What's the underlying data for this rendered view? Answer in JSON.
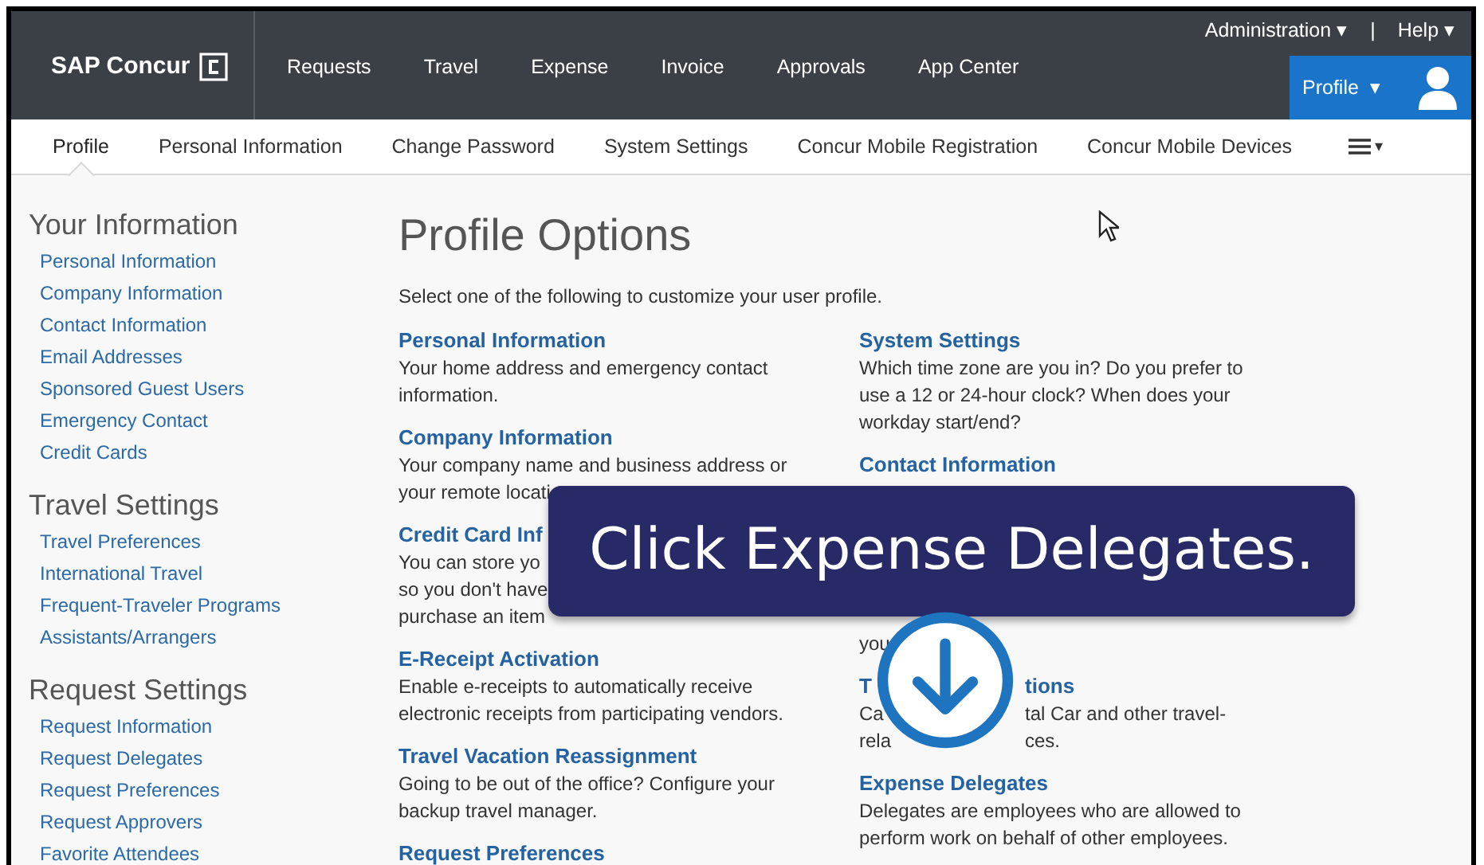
{
  "header": {
    "logo": "SAP Concur",
    "nav": [
      "Requests",
      "Travel",
      "Expense",
      "Invoice",
      "Approvals",
      "App Center"
    ],
    "utility": [
      {
        "label": "Administration",
        "caret": "▾"
      },
      {
        "label": "Help",
        "caret": "▾"
      }
    ],
    "separator": "|",
    "profile_button": {
      "label": "Profile",
      "caret": "▾"
    }
  },
  "subnav": {
    "tabs": [
      {
        "label": "Profile",
        "selected": true
      },
      {
        "label": "Personal Information",
        "selected": false
      },
      {
        "label": "Change Password",
        "selected": false
      },
      {
        "label": "System Settings",
        "selected": false
      },
      {
        "label": "Concur Mobile Registration",
        "selected": false
      },
      {
        "label": "Concur Mobile Devices",
        "selected": false
      }
    ],
    "more_caret": "▾"
  },
  "sidebar": [
    {
      "heading": "Your Information",
      "items": [
        "Personal Information",
        "Company Information",
        "Contact Information",
        "Email Addresses",
        "Sponsored Guest Users",
        "Emergency Contact",
        "Credit Cards"
      ]
    },
    {
      "heading": "Travel Settings",
      "items": [
        "Travel Preferences",
        "International Travel",
        "Frequent-Traveler Programs",
        "Assistants/Arrangers"
      ]
    },
    {
      "heading": "Request Settings",
      "items": [
        "Request Information",
        "Request Delegates",
        "Request Preferences",
        "Request Approvers",
        "Favorite Attendees"
      ]
    }
  ],
  "main": {
    "title": "Profile Options",
    "intro": "Select one of the following to customize your user profile.",
    "columns": [
      [
        {
          "heading": [
            {
              "text": "Personal Information"
            }
          ],
          "lines": [
            {
              "parts": [
                "Your home address and emergency contact"
              ]
            },
            {
              "parts": [
                "information."
              ]
            }
          ]
        },
        {
          "heading": [
            {
              "text": "Company Information"
            }
          ],
          "lines": [
            {
              "parts": [
                "Your company name and business address or"
              ]
            },
            {
              "parts": [
                "your remote locati"
              ]
            }
          ]
        },
        {
          "heading": [
            {
              "text": "Credit Card Inf"
            }
          ],
          "lines": [
            {
              "parts": [
                "You can store yo"
              ]
            },
            {
              "parts": [
                "so you don't have"
              ]
            },
            {
              "parts": [
                "purchase an item"
              ]
            }
          ]
        },
        {
          "heading": [
            {
              "text": "E-Receipt Activation"
            }
          ],
          "lines": [
            {
              "parts": [
                "Enable e-receipts to automatically receive"
              ]
            },
            {
              "parts": [
                "electronic receipts from participating vendors."
              ]
            }
          ]
        },
        {
          "heading": [
            {
              "text": "Travel Vacation Reassignment"
            }
          ],
          "lines": [
            {
              "parts": [
                "Going to be out of the office? Configure your"
              ]
            },
            {
              "parts": [
                "backup travel manager."
              ]
            }
          ]
        },
        {
          "heading": [
            {
              "text": "Request Preferences"
            }
          ]
        }
      ],
      [
        {
          "heading": [
            {
              "text": "System Settings"
            }
          ],
          "lines": [
            {
              "parts": [
                "Which time zone are you in? Do you prefer to"
              ]
            },
            {
              "parts": [
                "use a 12 or 24-hour clock? When does your"
              ]
            },
            {
              "parts": [
                "workday start/end?"
              ]
            }
          ]
        },
        {
          "heading": [
            {
              "text": "Contact Information"
            }
          ],
          "lines": [
            {
              "parts": [
                "you"
              ],
              "covered_above": true
            }
          ]
        },
        {
          "heading": [
            {
              "text": "T"
            },
            {
              "text": "tions"
            }
          ],
          "lines": [
            {
              "parts": [
                "Ca",
                "tal Car and other travel-"
              ]
            },
            {
              "parts": [
                "rela",
                "ces."
              ]
            }
          ]
        },
        {
          "heading": [
            {
              "text": "Expense Delegates"
            }
          ],
          "lines": [
            {
              "parts": [
                "Delegates are employees who are allowed to"
              ]
            },
            {
              "parts": [
                "perform work on behalf of other employees."
              ]
            }
          ]
        }
      ]
    ]
  },
  "callout": {
    "text": "Click Expense Delegates."
  }
}
